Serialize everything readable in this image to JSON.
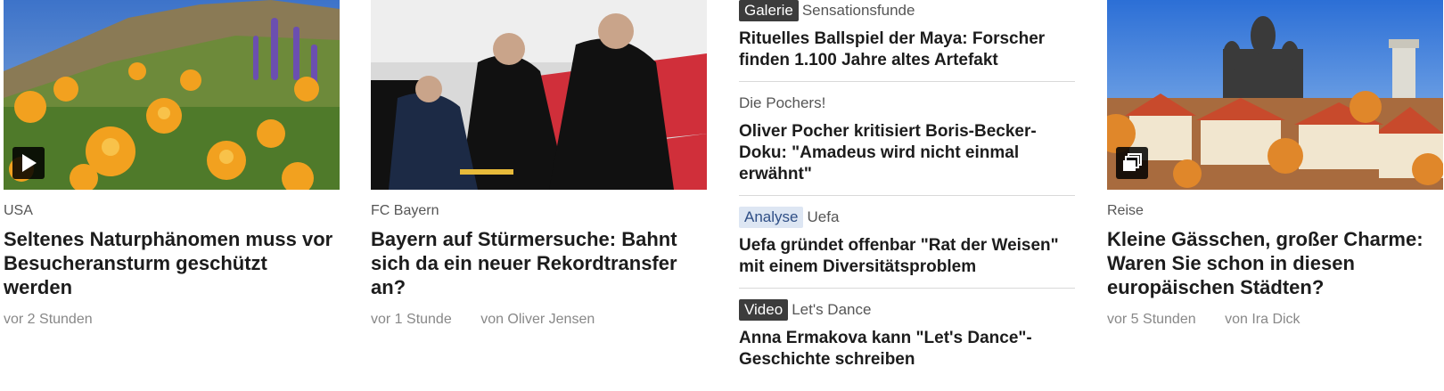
{
  "cards": [
    {
      "kicker": "USA",
      "headline": "Seltenes Naturphänomen muss vor Besucheransturm geschützt werden",
      "time": "vor 2 Stunden",
      "author": "",
      "media_icon": "play-icon"
    },
    {
      "kicker": "FC Bayern",
      "headline": "Bayern auf Stürmersuche: Bahnt sich da ein neuer Rekordtransfer an?",
      "time": "vor 1 Stunde",
      "author": "von Oliver Jensen",
      "media_icon": ""
    },
    {
      "kicker": "Reise",
      "headline": "Kleine Gässchen, großer Charme: Waren Sie schon in diesen europäischen Städten?",
      "time": "vor 5 Stunden",
      "author": "von Ira Dick",
      "media_icon": "gallery-icon"
    }
  ],
  "list": [
    {
      "tag": "Galerie",
      "tag_style": "dark",
      "kicker": "Sensationsfunde",
      "title": "Rituelles Ballspiel der Maya: Forscher finden 1.100 Jahre altes Artefakt"
    },
    {
      "tag": "",
      "tag_style": "",
      "kicker": "Die Pochers!",
      "title": "Oliver Pocher kritisiert Boris-Becker-Doku: \"Amadeus wird nicht einmal erwähnt\""
    },
    {
      "tag": "Analyse",
      "tag_style": "blue",
      "kicker": "Uefa",
      "title": "Uefa gründet offenbar \"Rat der Weisen\" mit einem Diversitätsproblem"
    },
    {
      "tag": "Video",
      "tag_style": "dark",
      "kicker": "Let's Dance",
      "title": "Anna Ermakova kann \"Let's Dance\"-Geschichte schreiben"
    }
  ]
}
